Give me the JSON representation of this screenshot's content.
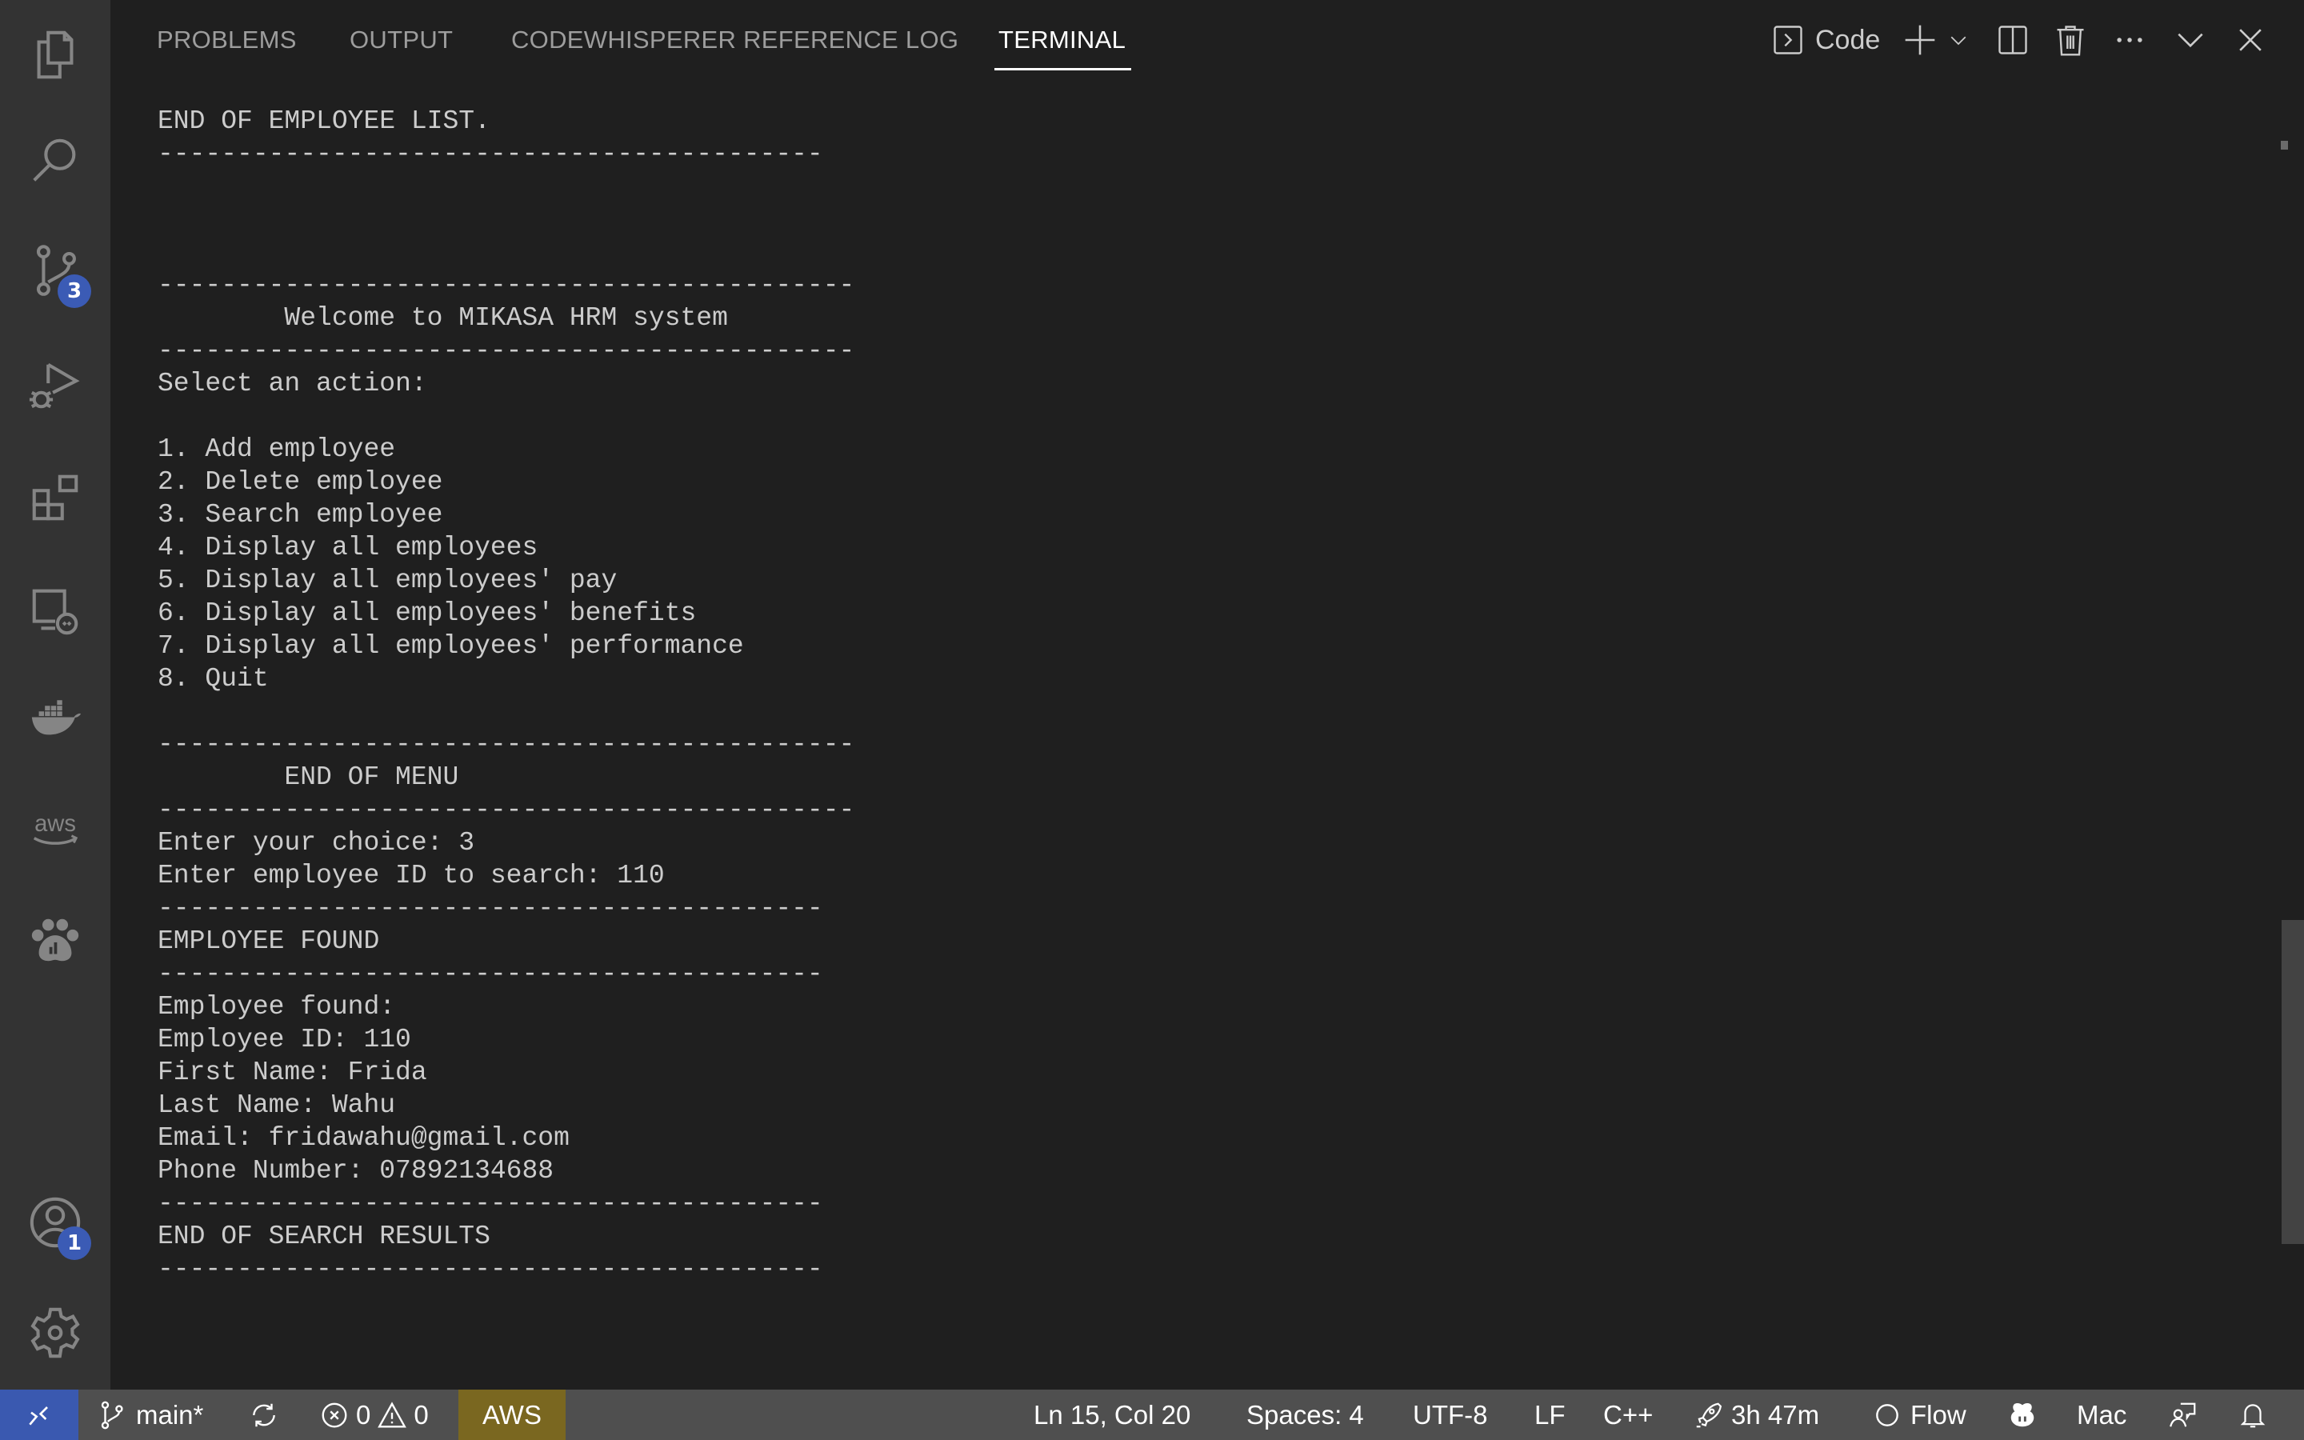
{
  "activity_bar": {
    "items": [
      {
        "name": "explorer",
        "icon": "files-icon"
      },
      {
        "name": "search",
        "icon": "search-icon"
      },
      {
        "name": "source-control",
        "icon": "source-control-icon",
        "badge": "3"
      },
      {
        "name": "run-debug",
        "icon": "run-debug-icon"
      },
      {
        "name": "extensions",
        "icon": "extensions-icon"
      },
      {
        "name": "remote-explorer",
        "icon": "remote-explorer-icon"
      },
      {
        "name": "docker",
        "icon": "docker-icon"
      },
      {
        "name": "aws",
        "icon": "aws-icon"
      },
      {
        "name": "datadog",
        "icon": "paw-icon"
      }
    ],
    "bottom": [
      {
        "name": "accounts",
        "icon": "account-icon",
        "badge": "1"
      },
      {
        "name": "manage",
        "icon": "gear-icon"
      }
    ]
  },
  "panel": {
    "tabs": [
      {
        "label": "PROBLEMS",
        "active": false
      },
      {
        "label": "OUTPUT",
        "active": false
      },
      {
        "label": "CODEWHISPERER REFERENCE LOG",
        "active": false
      },
      {
        "label": "TERMINAL",
        "active": true
      }
    ],
    "actions": {
      "terminal_profile_label": "Code",
      "new_terminal": "plus-icon",
      "profiles_dropdown": "chevron-down-icon",
      "split": "split-icon",
      "kill": "trash-icon",
      "more": "ellipsis-icon",
      "maximize": "chevron-up-down-icon",
      "close": "close-icon"
    }
  },
  "terminal": {
    "lines": [
      "END OF EMPLOYEE LIST.",
      "------------------------------------------",
      "",
      "",
      "",
      "--------------------------------------------",
      "        Welcome to MIKASA HRM system",
      "--------------------------------------------",
      "Select an action:",
      "",
      "1. Add employee",
      "2. Delete employee",
      "3. Search employee",
      "4. Display all employees",
      "5. Display all employees' pay",
      "6. Display all employees' benefits",
      "7. Display all employees' performance",
      "8. Quit",
      "",
      "--------------------------------------------",
      "        END OF MENU",
      "--------------------------------------------",
      "Enter your choice: 3",
      "Enter employee ID to search: 110",
      "------------------------------------------",
      "EMPLOYEE FOUND",
      "------------------------------------------",
      "Employee found:",
      "Employee ID: 110",
      "First Name: Frida",
      "Last Name: Wahu",
      "Email: fridawahu@gmail.com",
      "Phone Number: 07892134688",
      "------------------------------------------",
      "END OF SEARCH RESULTS",
      "------------------------------------------"
    ]
  },
  "status_bar": {
    "branch": "main*",
    "errors": "0",
    "warnings": "0",
    "aws": "AWS",
    "cursor": "Ln 15, Col 20",
    "indent": "Spaces: 4",
    "encoding": "UTF-8",
    "eol": "LF",
    "language": "C++",
    "timer": "3h 47m",
    "flow": "Flow",
    "keyboard": "Mac"
  },
  "colors": {
    "accent": "#3a59b0",
    "aws_bg": "#7a6720",
    "status_bg": "#4f4f4f",
    "panel_bg": "#1f1f1f",
    "activity_bg": "#333333"
  }
}
